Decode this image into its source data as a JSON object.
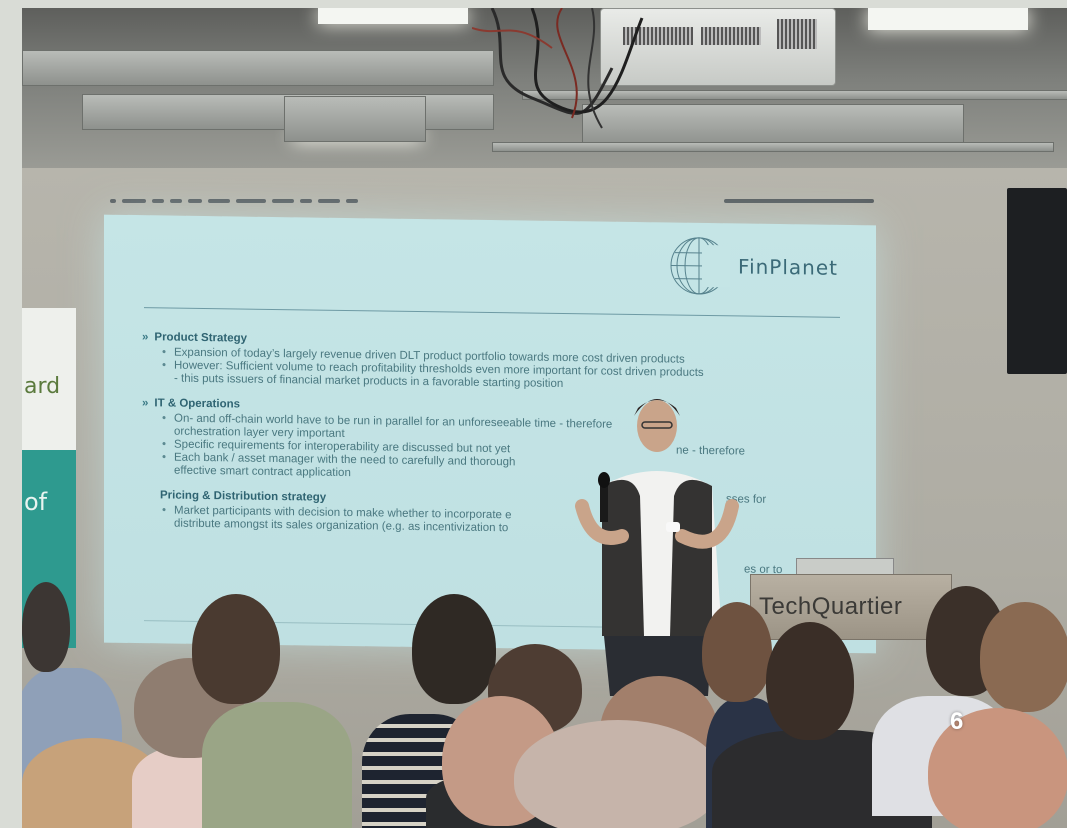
{
  "slide": {
    "brand": "FinPlanet",
    "sections": [
      {
        "title": "Product Strategy",
        "bullets": [
          "Expansion of today’s largely revenue driven DLT product portfolio towards more cost driven products",
          "However: Sufficient volume to reach profitability thresholds even more important for cost driven products",
          "- this puts issuers of financial market products in a favorable starting position"
        ]
      },
      {
        "title": "IT & Operations",
        "bullets": [
          "On- and off-chain world have to be run in parallel for an unforeseeable time - therefore",
          "orchestration layer very important",
          "Specific requirements for interoperability are discussed but not yet",
          "Each bank / asset manager with the need to carefully and thorough",
          "effective smart contract application"
        ]
      },
      {
        "title": "Pricing & Distribution strategy",
        "bullets": [
          "Market participants with decision to make whether to incorporate e",
          "distribute amongst its sales organization (e.g. as incentivization to"
        ]
      }
    ],
    "trailing_fragments": [
      "ne - therefore",
      "sses for",
      "es or to"
    ]
  },
  "banner": {
    "top_text": "ard",
    "bottom_text": "of"
  },
  "podium": {
    "label": "TechQuartier"
  },
  "page_number": "6",
  "colors": {
    "screen": "#c5e5e6",
    "slide_text": "#4a7880",
    "banner_teal": "#2e9a8f",
    "wall": "#b0aea5"
  }
}
